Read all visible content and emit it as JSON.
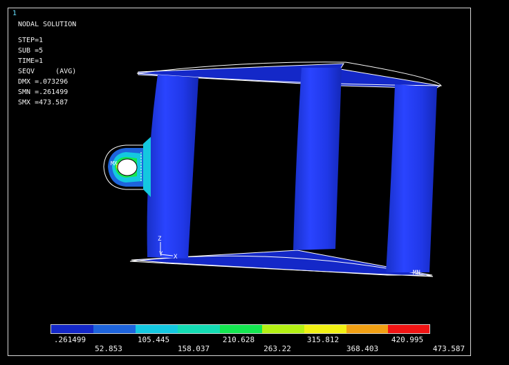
{
  "window": {
    "number": "1"
  },
  "solution_header": {
    "title": "NODAL SOLUTION",
    "lines": [
      "STEP=1",
      "SUB =5",
      "TIME=1",
      "SEQV     (AVG)",
      "DMX =.073296",
      "SMN =.261499",
      "SMX =473.587"
    ]
  },
  "markers": {
    "mx": "MX",
    "mn": "MN"
  },
  "triad": {
    "z": "Z",
    "y": "Y",
    "x": "X"
  },
  "legend": {
    "colors": [
      "#1428c8",
      "#1e64dc",
      "#14c8e0",
      "#14dcb4",
      "#14e650",
      "#b4f014",
      "#f0f014",
      "#f0a014",
      "#f01414"
    ],
    "top_labels": [
      ".261499",
      "105.445",
      "210.628",
      "315.812",
      "420.995"
    ],
    "bottom_labels": [
      "52.853",
      "158.037",
      "263.22",
      "368.403",
      "473.587"
    ]
  }
}
